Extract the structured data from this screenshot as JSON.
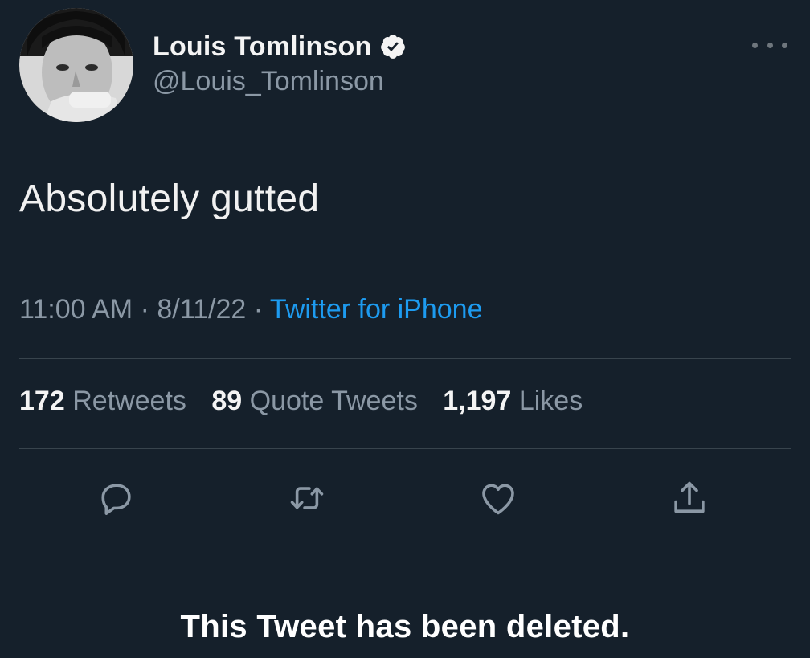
{
  "author": {
    "display_name": "Louis Tomlinson",
    "handle": "@Louis_Tomlinson",
    "verified": true
  },
  "tweet": {
    "text": "Absolutely gutted",
    "time": "11:00 AM",
    "separator": "·",
    "date": "8/11/22",
    "source": "Twitter for iPhone"
  },
  "stats": {
    "retweets_count": "172",
    "retweets_label": "Retweets",
    "quotes_count": "89",
    "quotes_label": "Quote Tweets",
    "likes_count": "1,197",
    "likes_label": "Likes"
  },
  "actions": {
    "reply_icon": "reply-icon",
    "retweet_icon": "retweet-icon",
    "like_icon": "heart-icon",
    "share_icon": "share-icon"
  },
  "overlay": {
    "deleted_message": "This Tweet has been deleted."
  },
  "colors": {
    "background": "#15202b",
    "accent": "#1d9bf0",
    "secondary_text": "#8b98a5",
    "divider": "#38444d"
  }
}
